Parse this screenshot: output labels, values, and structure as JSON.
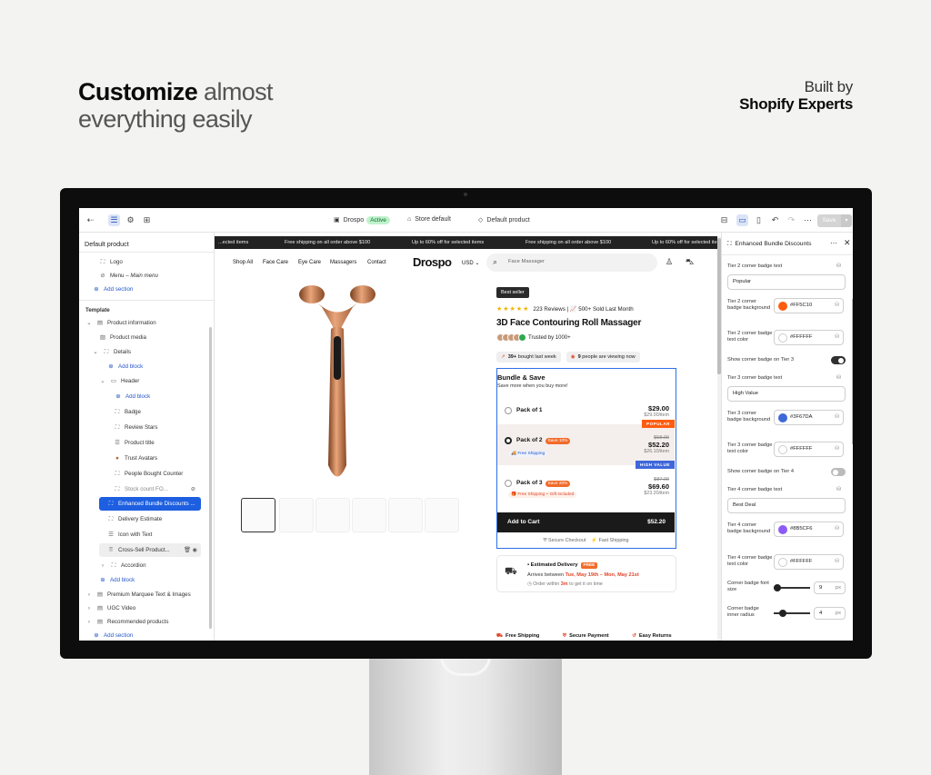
{
  "hero": {
    "title_bold": "Customize",
    "title_rest": " almost",
    "title_line2": "everything easily"
  },
  "built": {
    "line1": "Built by",
    "line2": "Shopify Experts"
  },
  "editor": {
    "topbar": {
      "store_name": "Drospo",
      "status": "Active",
      "theme": "Store default",
      "template": "Default product",
      "save_label": "Save"
    },
    "left_panel": {
      "title": "Default product",
      "header_items": [
        {
          "label": "Logo",
          "icon": "section-icon"
        },
        {
          "label": "Menu",
          "sublabel": "Main menu",
          "icon": "link-icon"
        }
      ],
      "add_section": "Add section",
      "template_label": "Template",
      "tree": [
        {
          "label": "Product information"
        },
        {
          "label": "Product media"
        },
        {
          "label": "Details"
        },
        {
          "label": "Add block"
        },
        {
          "label": "Header"
        },
        {
          "label": "Add block"
        },
        {
          "label": "Badge"
        },
        {
          "label": "Review Stars"
        },
        {
          "label": "Product title"
        },
        {
          "label": "Trust Avatars"
        },
        {
          "label": "People Bought Counter"
        },
        {
          "label": "Stock count FO..."
        },
        {
          "label": "Enhanced Bundle Discounts ..."
        },
        {
          "label": "Delivery Estimate"
        },
        {
          "label": "Icon with Text"
        },
        {
          "label": "Cross-Sell Product..."
        },
        {
          "label": "Accordion"
        },
        {
          "label": "Add block"
        },
        {
          "label": "Premium Marquee Text & Images"
        },
        {
          "label": "UGC Video"
        },
        {
          "label": "Recommended products"
        },
        {
          "label": "Add section"
        }
      ]
    },
    "store": {
      "ticker": [
        "...ected items",
        "Free shipping on all order above $100",
        "Up to 60% off for selected items",
        "Free shipping on all order above $100",
        "Up to 60% off for selected items"
      ],
      "nav": [
        "Shop All",
        "Face Care",
        "Eye Care",
        "Massagers",
        "Contact"
      ],
      "logo": "Drospo",
      "currency": "USD",
      "search_placeholder": "Face Massager",
      "badge": "Best seller",
      "reviews": "223 Reviews",
      "sold": "500+ Sold Last Month",
      "title": "3D Face Contouring Roll Massager",
      "trusted": "Trusted by 1000+",
      "bought_count": "39+",
      "bought_text": " bought last week",
      "viewing_count": "9",
      "viewing_text": " people are viewing now",
      "bundle": {
        "title": "Bundle & Save",
        "subtitle": "Save more when you buy more!",
        "packs": [
          {
            "name": "Pack of 1",
            "tag": "",
            "note": "",
            "old": "",
            "price": "$29.00",
            "each": "$29.00/item",
            "corner": ""
          },
          {
            "name": "Pack of 2",
            "tag": "Save 10%",
            "note": "Free Shipping",
            "old": "$58.00",
            "price": "$52.20",
            "each": "$26.10/item",
            "corner": "POPULAR"
          },
          {
            "name": "Pack of 3",
            "tag": "Save 20%",
            "note": "Free Shipping + Gift included",
            "old": "$87.00",
            "price": "$69.60",
            "each": "$23.20/item",
            "corner": "HIGH VALUE"
          }
        ],
        "atc_label": "Add to Cart",
        "atc_price": "$52.20",
        "secure": "Secure Checkout",
        "fast": "Fast Shipping"
      },
      "delivery": {
        "title": "Estimated Delivery",
        "free": "FREE",
        "arrives": "Arrives between ",
        "dates": "Tue, May 19th – Mon, May 21st",
        "order_prefix": "Order within ",
        "order_time": "3m",
        "order_suffix": " to get it on time"
      },
      "footer": [
        "Free Shipping",
        "Secure Payment",
        "Easy Returns"
      ]
    },
    "right_panel": {
      "title": "Enhanced Bundle Discounts",
      "t2_text_label": "Tier 2 corner badge text",
      "t2_text": "Popular",
      "t2_bg_label": "Tier 2 corner badge background",
      "t2_bg": "#FF5C10",
      "t2_tc_label": "Tier 2 corner badge text color",
      "t2_tc": "#FFFFFF",
      "t3_show_label": "Show corner badge on Tier 3",
      "t3_text_label": "Tier 3 corner badge text",
      "t3_text": "High Value",
      "t3_bg_label": "Tier 3 corner badge background",
      "t3_bg": "#3F67DA",
      "t3_tc_label": "Tier 3 corner badge text color",
      "t3_tc": "#FFFFFF",
      "t4_show_label": "Show corner badge on Tier 4",
      "t4_text_label": "Tier 4 corner badge text",
      "t4_text": "Best Deal",
      "t4_bg_label": "Tier 4 corner badge background",
      "t4_bg": "#8B5CF6",
      "t4_tc_label": "Tier 4 corner badge text color",
      "t4_tc": "#FFFFFF",
      "font_size_label": "Corner badge font size",
      "font_size": "9",
      "radius_label": "Corner badge inner radius",
      "radius": "4",
      "unit": "px",
      "t3_show": true,
      "t4_show": false
    }
  }
}
